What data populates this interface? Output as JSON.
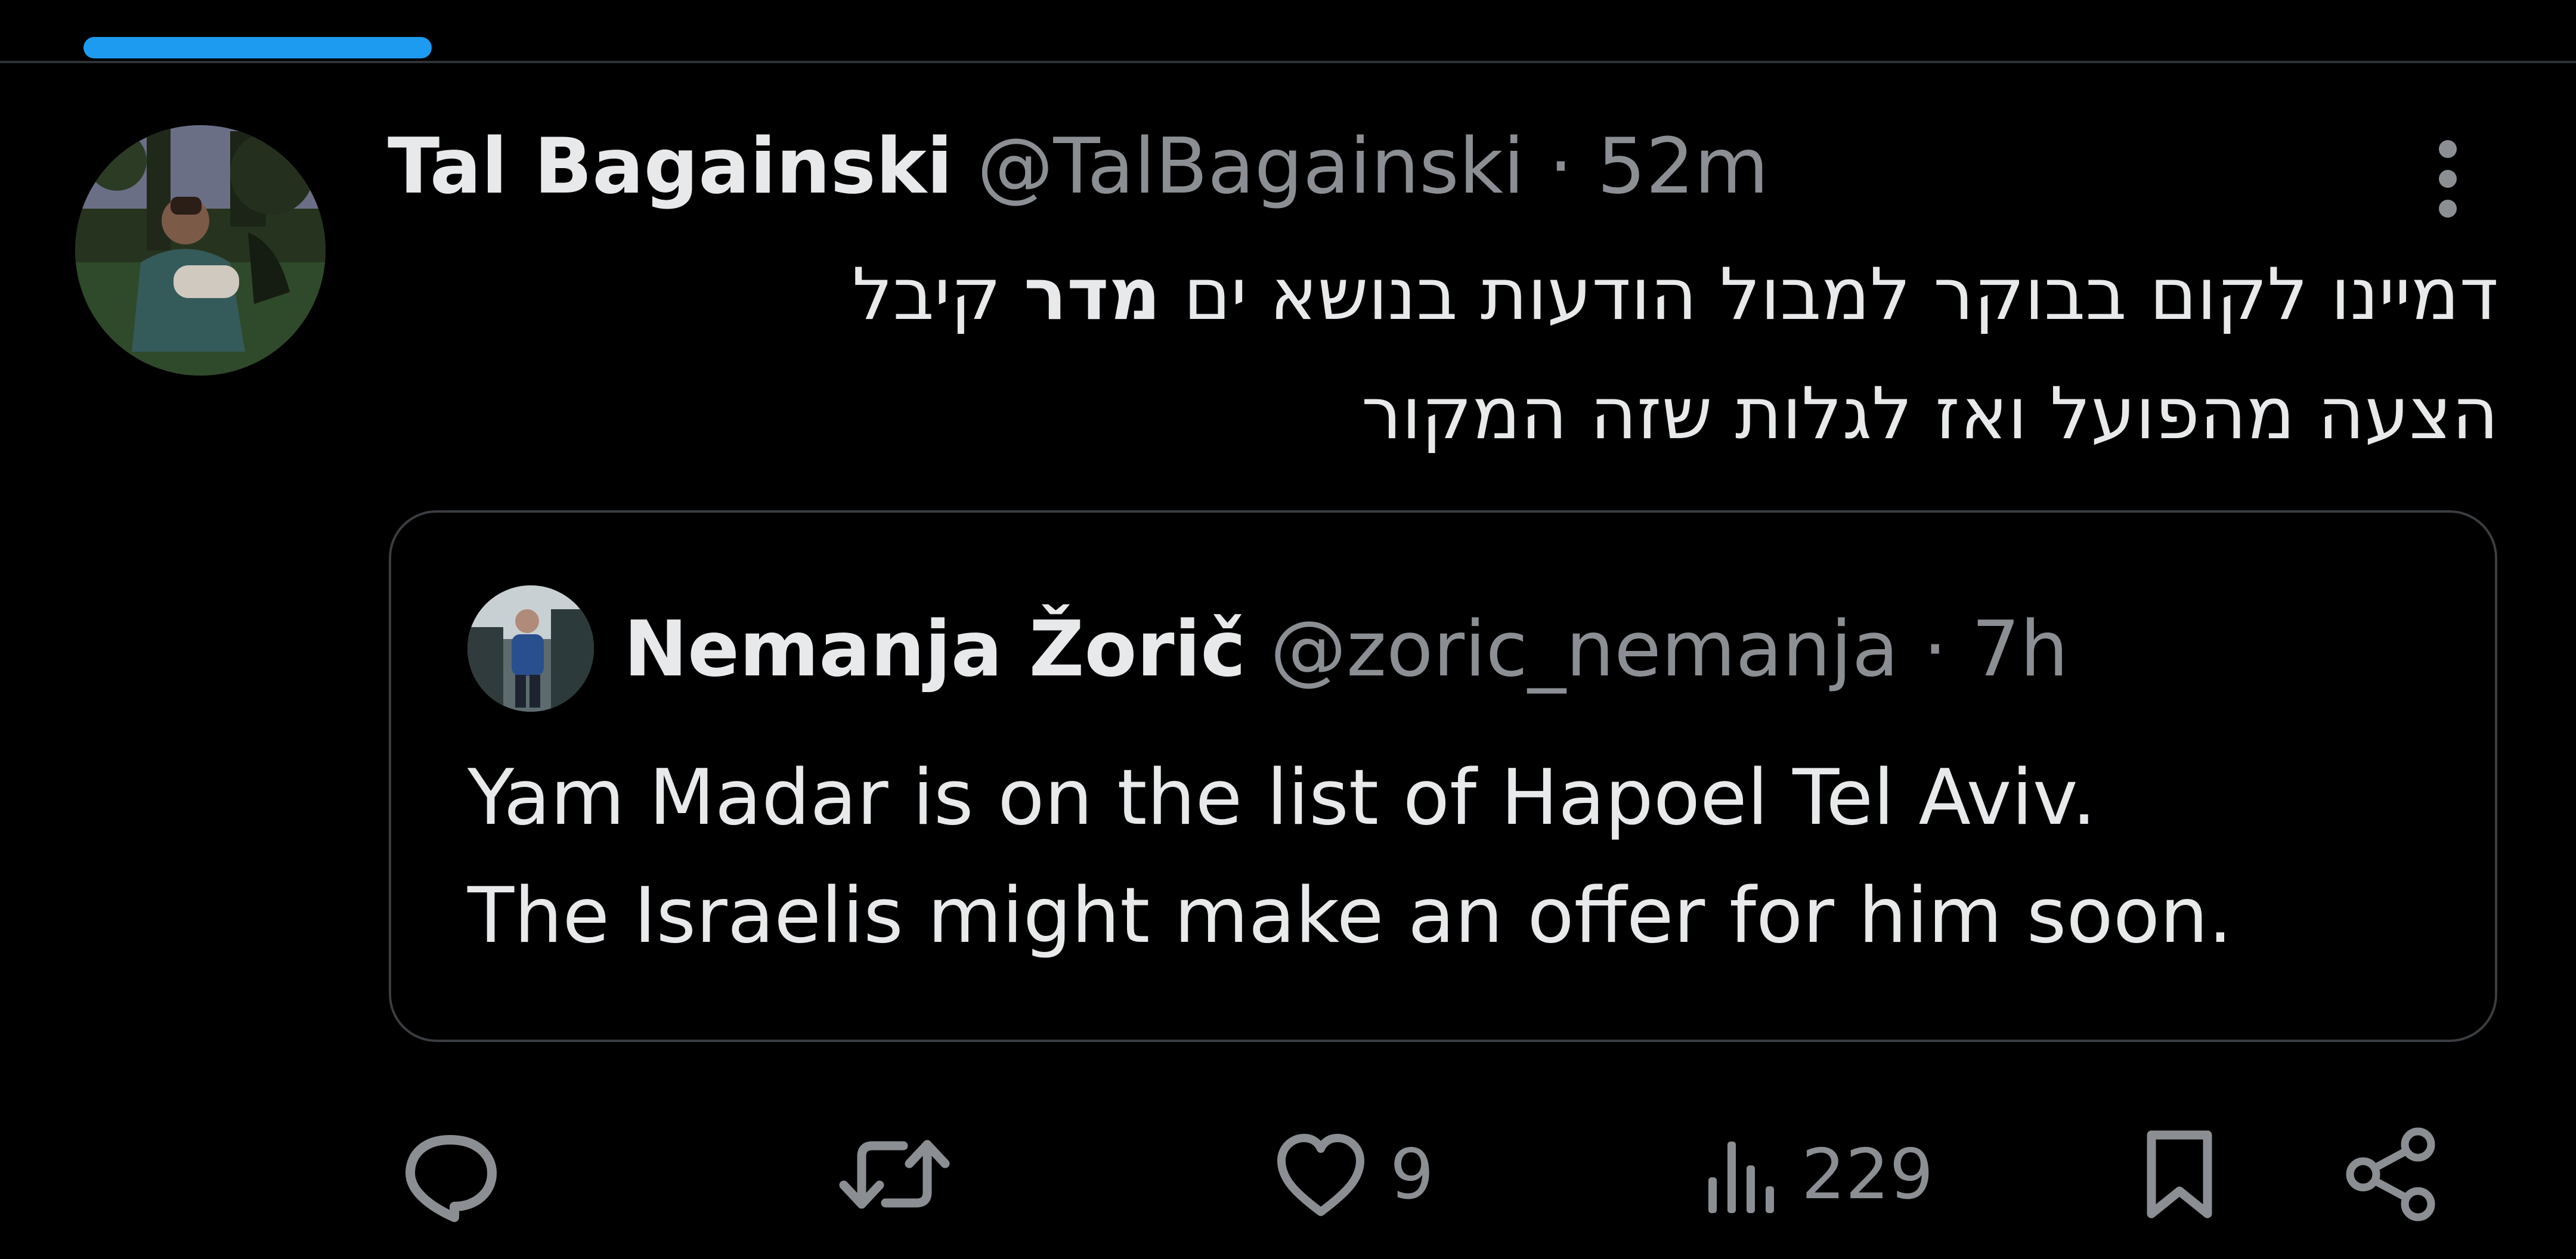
{
  "colors": {
    "background": "#000000",
    "accent": "#1d9bf0",
    "primary_text": "#e7e9ea",
    "secondary_text": "#8b8f94",
    "border": "#3a3d41"
  },
  "tweet": {
    "author_name": "Tal Bagainski",
    "author_handle": "@TalBagainski",
    "separator": "·",
    "time": "52m",
    "text_line1_before": "דמיינו לקום בבוקר למבול הודעות בנושא ים ",
    "text_line1_bold": "מדר",
    "text_line1_after": " קיבל",
    "text_line2": "הצעה מהפועל ואז לגלות שזה המקור"
  },
  "quoted": {
    "author_name": "Nemanja Žorič",
    "author_handle": "@zoric_nemanja",
    "separator": "·",
    "time": "7h",
    "text_line1": "Yam Madar is on the list of Hapoel Tel Aviv.",
    "text_line2": "The Israelis might make an offer for him soon."
  },
  "actions": {
    "reply_icon": "reply-icon",
    "retweet_icon": "retweet-icon",
    "like_icon": "heart-icon",
    "like_count": "9",
    "views_icon": "views-icon",
    "view_count": "229",
    "bookmark_icon": "bookmark-icon",
    "share_icon": "share-icon"
  }
}
